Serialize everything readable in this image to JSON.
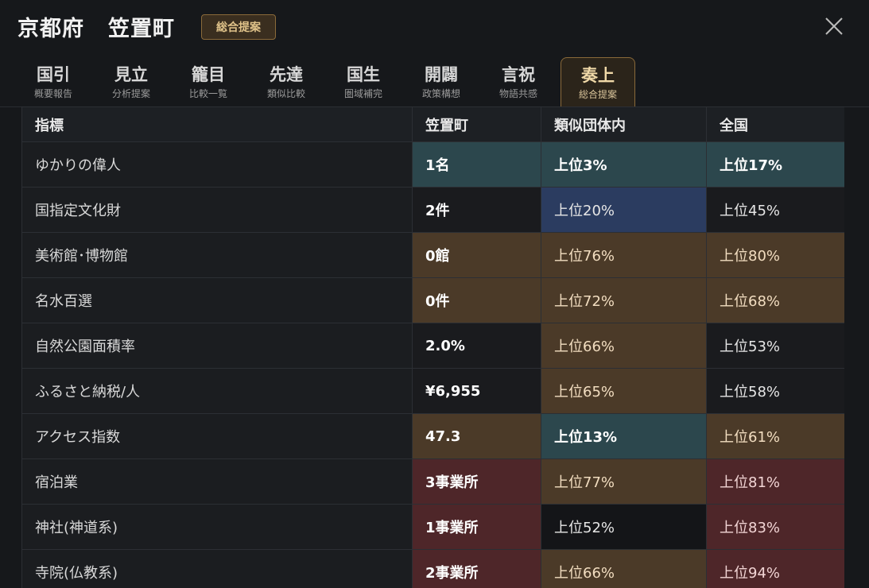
{
  "header": {
    "prefecture": "京都府",
    "town": "笠置町",
    "badge": "総合提案"
  },
  "tabs": [
    {
      "main": "国引",
      "sub": "概要報告"
    },
    {
      "main": "見立",
      "sub": "分析提案"
    },
    {
      "main": "籠目",
      "sub": "比較一覧"
    },
    {
      "main": "先達",
      "sub": "類似比較"
    },
    {
      "main": "国生",
      "sub": "圏域補完"
    },
    {
      "main": "開闢",
      "sub": "政策構想"
    },
    {
      "main": "言祝",
      "sub": "物語共感"
    },
    {
      "main": "奏上",
      "sub": "総合提案"
    }
  ],
  "active_tab": 7,
  "table": {
    "headers": [
      "指標",
      "笠置町",
      "類似団体内",
      "全国"
    ],
    "rows": [
      {
        "indicator": "ゆかりの偉人",
        "value": "1名",
        "similar": "上位3%",
        "national": "上位17%",
        "colors": [
          "t",
          "t",
          "t"
        ]
      },
      {
        "indicator": "国指定文化財",
        "value": "2件",
        "similar": "上位20%",
        "national": "上位45%",
        "colors": [
          "n",
          "b",
          "n"
        ]
      },
      {
        "indicator": "美術館･博物館",
        "value": "0館",
        "similar": "上位76%",
        "national": "上位80%",
        "colors": [
          "o",
          "o",
          "o"
        ]
      },
      {
        "indicator": "名水百選",
        "value": "0件",
        "similar": "上位72%",
        "national": "上位68%",
        "colors": [
          "o",
          "o",
          "o"
        ]
      },
      {
        "indicator": "自然公園面積率",
        "value": "2.0%",
        "similar": "上位66%",
        "national": "上位53%",
        "colors": [
          "n",
          "o",
          "n"
        ]
      },
      {
        "indicator": "ふるさと納税/人",
        "value": "¥6,955",
        "similar": "上位65%",
        "national": "上位58%",
        "colors": [
          "n",
          "o",
          "n"
        ]
      },
      {
        "indicator": "アクセス指数",
        "value": "47.3",
        "similar": "上位13%",
        "national": "上位61%",
        "colors": [
          "o",
          "t",
          "o"
        ]
      },
      {
        "indicator": "宿泊業",
        "value": "3事業所",
        "similar": "上位77%",
        "national": "上位81%",
        "colors": [
          "r",
          "o",
          "r"
        ]
      },
      {
        "indicator": "神社(神道系)",
        "value": "1事業所",
        "similar": "上位52%",
        "national": "上位83%",
        "colors": [
          "r",
          "d",
          "r"
        ]
      },
      {
        "indicator": "寺院(仏教系)",
        "value": "2事業所",
        "similar": "上位66%",
        "national": "上位94%",
        "colors": [
          "r",
          "o",
          "r"
        ]
      }
    ]
  },
  "colors": {
    "teal": "#2c474d",
    "blue": "#2b3c60",
    "orange": "#4b3a28",
    "red": "#4e2629",
    "accent_gold": "#e0c38a"
  },
  "icons": {
    "close": "close-icon"
  }
}
